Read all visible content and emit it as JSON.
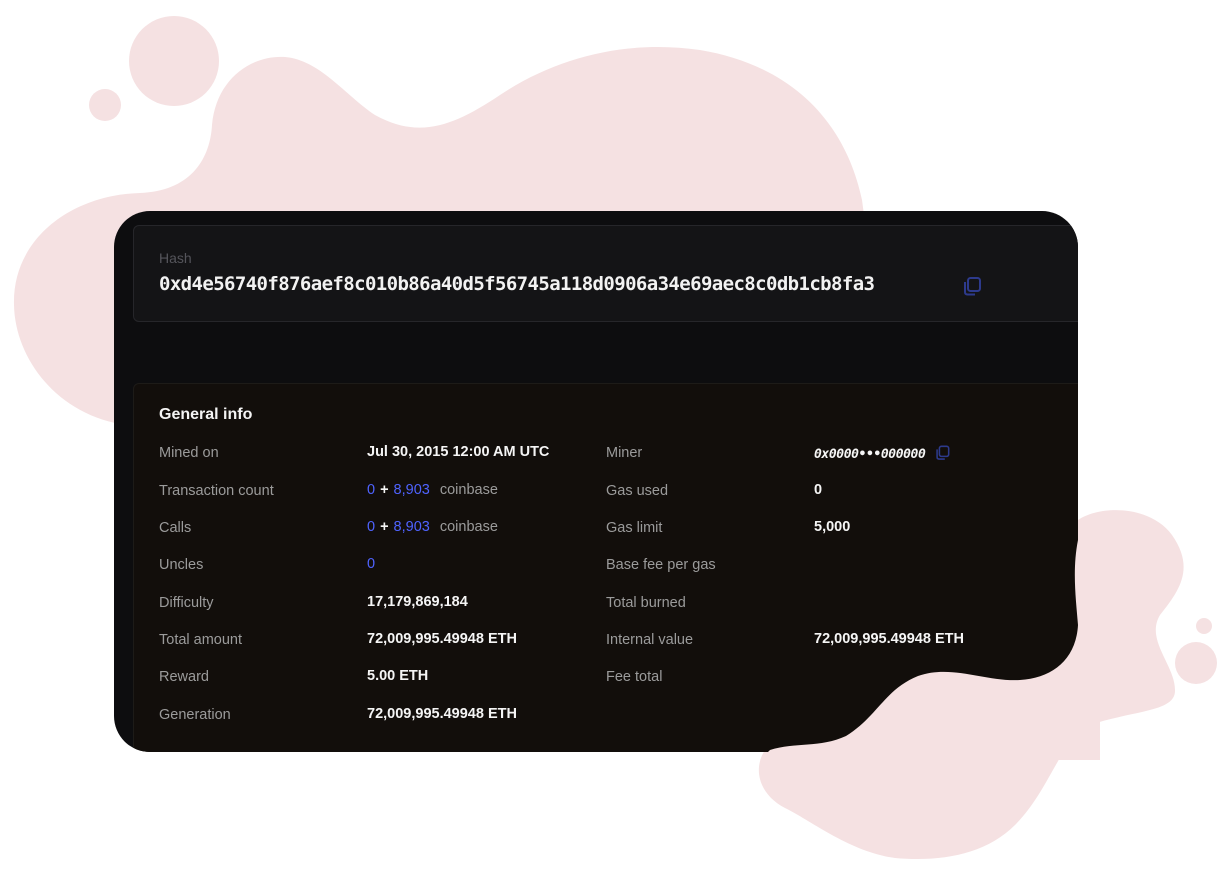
{
  "hash": {
    "label": "Hash",
    "value": "0xd4e56740f876aef8c010b86a40d5f56745a118d0906a34e69aec8c0db1cb8fa3"
  },
  "general_info": {
    "title": "General info",
    "left_rows": [
      {
        "label": "Mined on",
        "value": "Jul 30, 2015 12:00 AM UTC"
      },
      {
        "label": "Transaction count",
        "first": "0",
        "plus": "+",
        "second": "8,903",
        "suffix": "coinbase"
      },
      {
        "label": "Calls",
        "first": "0",
        "plus": "+",
        "second": "8,903",
        "suffix": "coinbase"
      },
      {
        "label": "Uncles",
        "value": "0"
      },
      {
        "label": "Difficulty",
        "value": "17,179,869,184"
      },
      {
        "label": "Total amount",
        "value": "72,009,995.49948 ETH"
      },
      {
        "label": "Reward",
        "value": "5.00 ETH"
      },
      {
        "label": "Generation",
        "value": "72,009,995.49948 ETH"
      }
    ],
    "right_rows": [
      {
        "label": "Miner",
        "value": "0x0000•••000000"
      },
      {
        "label": "Gas used",
        "value": "0"
      },
      {
        "label": "Gas limit",
        "value": "5,000"
      },
      {
        "label": "Base fee per gas",
        "value": ""
      },
      {
        "label": "Total burned",
        "value": ""
      },
      {
        "label": "Internal value",
        "value": "72,009,995.49948 ETH"
      },
      {
        "label": "Fee total",
        "value": ""
      }
    ]
  },
  "icons": {
    "hash_copy": "copy-icon",
    "miner_copy": "copy-icon"
  },
  "colors": {
    "background_blob": "#f5e1e2",
    "card": "#0d0d0f",
    "link": "#4f63ff",
    "icon": "#2d3a8c"
  }
}
